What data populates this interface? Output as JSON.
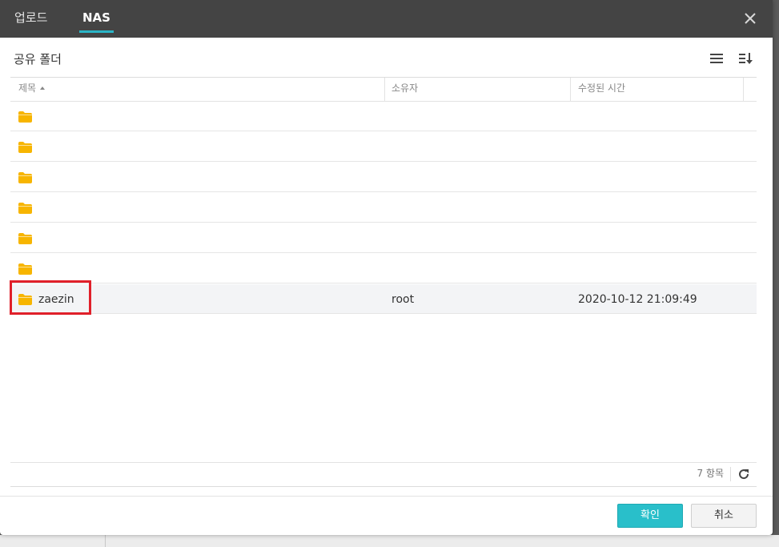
{
  "tabs": [
    {
      "label": "업로드",
      "active": false
    },
    {
      "label": "NAS",
      "active": true
    }
  ],
  "icons": {
    "close": "close-icon",
    "list_view": "list-view-icon",
    "sort": "sort-icon",
    "folder": "folder-icon",
    "refresh": "refresh-icon"
  },
  "header": {
    "title": "공유 폴더"
  },
  "table": {
    "columns": [
      "제목",
      "소유자",
      "수정된 시간"
    ],
    "sort_column": "제목",
    "sort_direction": "ascending",
    "rows": [
      {
        "name": "",
        "owner": "",
        "modified": ""
      },
      {
        "name": "",
        "owner": "",
        "modified": ""
      },
      {
        "name": "",
        "owner": "",
        "modified": ""
      },
      {
        "name": "",
        "owner": "",
        "modified": ""
      },
      {
        "name": "",
        "owner": "",
        "modified": ""
      },
      {
        "name": "",
        "owner": "",
        "modified": ""
      },
      {
        "name": "zaezin",
        "owner": "root",
        "modified": "2020-10-12 21:09:49",
        "selected": true
      }
    ]
  },
  "footer": {
    "item_count": "7 항목"
  },
  "buttons": {
    "ok": "확인",
    "cancel": "취소"
  },
  "colors": {
    "accent": "#29bfca",
    "tab_underline": "#2bb5c6",
    "folder": "#f7b500",
    "highlight": "#e0202a",
    "titlebar": "#444444"
  }
}
